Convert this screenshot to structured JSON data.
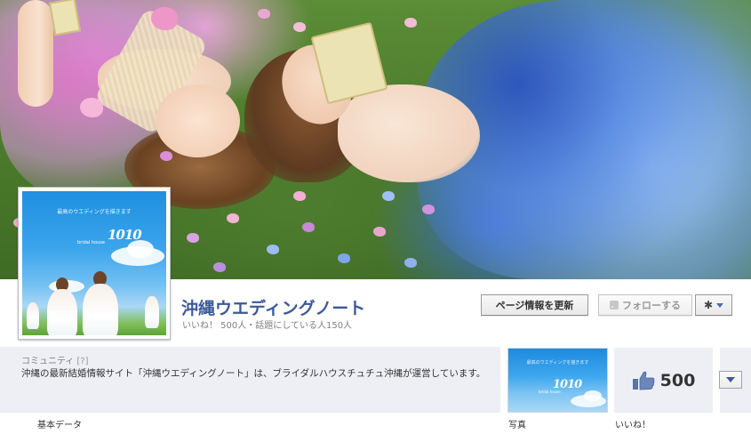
{
  "page": {
    "name": "沖縄ウエディングノート",
    "stats": "いいね！ 500人・話題にしている人150人"
  },
  "header_buttons": {
    "update_label": "ページ情報を更新",
    "follow_label": "フォローする",
    "follow_icon": "rss-icon",
    "settings_icon": "gear-icon"
  },
  "profile_picture": {
    "tagline": "最高のウエディングを描きます",
    "logo": "1010",
    "sub": "bridal house"
  },
  "info": {
    "category": "コミュニティ",
    "help": "[?]",
    "description": "沖縄の最新結婚情報サイト「沖縄ウエディングノート」は、ブライダルハウスチュチュ沖縄が運営しています。"
  },
  "tabs": {
    "basic": "基本データ",
    "photos": "写真",
    "likes": "いいね！",
    "likes_count": "500"
  },
  "colors": {
    "link_blue": "#3b5998",
    "info_bg": "#edeff4"
  }
}
